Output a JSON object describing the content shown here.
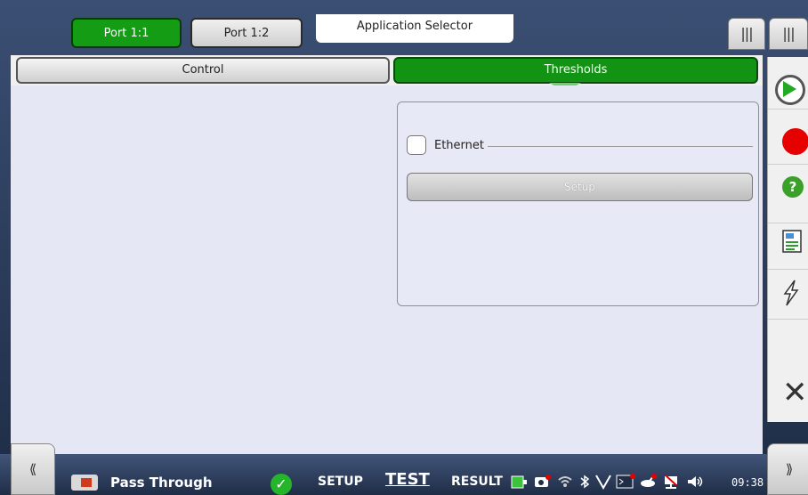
{
  "header": {
    "port_tabs": [
      "Port 1:1",
      "Port 1:2"
    ],
    "app_selector_label": "Application Selector",
    "menu_grip_left": "|||",
    "menu_grip_right": "|||"
  },
  "tabs": {
    "control_label": "Control",
    "thresholds_label": "Thresholds"
  },
  "thresholds_panel": {
    "ethernet_label": "Ethernet",
    "ethernet_checked": false,
    "setup_label": "Setup"
  },
  "sidebar": {
    "help_glyph": "?",
    "close_glyph": "✕"
  },
  "bottombar": {
    "left_nav_glyph": "⟪",
    "right_nav_glyph": "⟫",
    "app_name": "Pass Through",
    "status_glyph": "✓",
    "modes": [
      "SETUP",
      "TEST",
      "RESULT"
    ],
    "active_mode": "TEST",
    "clock": "09:38"
  },
  "colors": {
    "active_green": "#149c14",
    "record_red": "#e60000",
    "help_green": "#3aa02a",
    "status_green": "#25b52a"
  }
}
